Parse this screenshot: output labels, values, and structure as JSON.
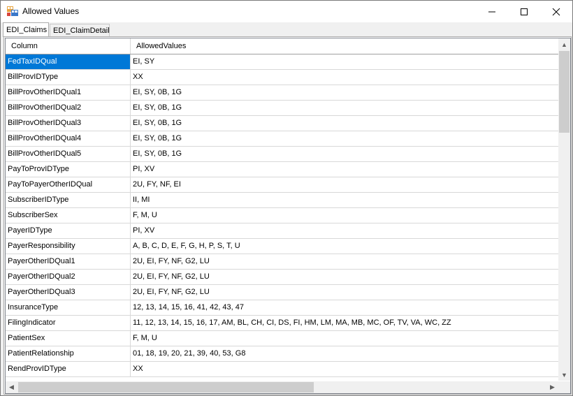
{
  "window": {
    "title": "Allowed Values"
  },
  "tabs": [
    {
      "label": "EDI_Claims"
    },
    {
      "label": "EDI_ClaimDetail"
    }
  ],
  "grid": {
    "columns": [
      "Column",
      "AllowedValues"
    ],
    "rows": [
      {
        "column": "FedTaxIDQual",
        "allowed": "EI, SY"
      },
      {
        "column": "BillProvIDType",
        "allowed": "XX"
      },
      {
        "column": "BillProvOtherIDQual1",
        "allowed": "EI, SY, 0B, 1G"
      },
      {
        "column": "BillProvOtherIDQual2",
        "allowed": "EI, SY, 0B, 1G"
      },
      {
        "column": "BillProvOtherIDQual3",
        "allowed": "EI, SY, 0B, 1G"
      },
      {
        "column": "BillProvOtherIDQual4",
        "allowed": "EI, SY, 0B, 1G"
      },
      {
        "column": "BillProvOtherIDQual5",
        "allowed": "EI, SY, 0B, 1G"
      },
      {
        "column": "PayToProvIDType",
        "allowed": "PI, XV"
      },
      {
        "column": "PayToPayerOtherIDQual",
        "allowed": "2U, FY, NF, EI"
      },
      {
        "column": "SubscriberIDType",
        "allowed": "II, MI"
      },
      {
        "column": "SubscriberSex",
        "allowed": "F, M, U"
      },
      {
        "column": "PayerIDType",
        "allowed": "PI, XV"
      },
      {
        "column": "PayerResponsibility",
        "allowed": "A, B, C, D, E, F, G, H, P, S, T, U"
      },
      {
        "column": "PayerOtherIDQual1",
        "allowed": "2U, EI, FY, NF, G2, LU"
      },
      {
        "column": "PayerOtherIDQual2",
        "allowed": "2U, EI, FY, NF, G2, LU"
      },
      {
        "column": "PayerOtherIDQual3",
        "allowed": "2U, EI, FY, NF, G2, LU"
      },
      {
        "column": "InsuranceType",
        "allowed": "12, 13, 14, 15, 16, 41, 42, 43, 47"
      },
      {
        "column": "FilingIndicator",
        "allowed": "11, 12, 13, 14, 15, 16, 17, AM, BL, CH, CI, DS, FI, HM, LM, MA, MB, MC, OF, TV, VA, WC, ZZ"
      },
      {
        "column": "PatientSex",
        "allowed": "F, M, U"
      },
      {
        "column": "PatientRelationship",
        "allowed": "01, 18, 19, 20, 21, 39, 40, 53, G8"
      },
      {
        "column": "RendProvIDType",
        "allowed": "XX"
      }
    ]
  },
  "colors": {
    "selection": "#0078d7",
    "gridline": "#d8d8d8"
  }
}
